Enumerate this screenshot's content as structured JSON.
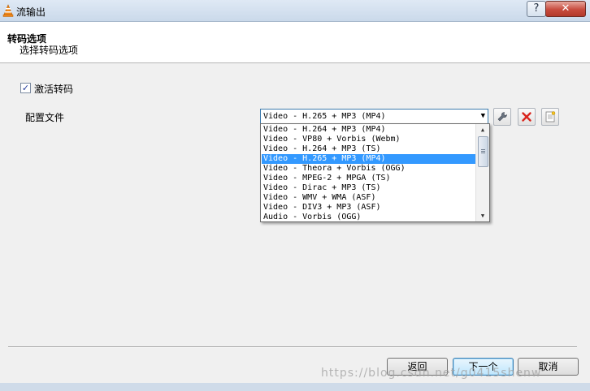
{
  "window": {
    "title": "流输出",
    "help_label": "?",
    "close_label": "✕"
  },
  "header": {
    "title": "转码选项",
    "subtitle": "选择转码选项"
  },
  "transcode": {
    "checkbox_label": "激活转码",
    "checked": true,
    "check_mark": "✓"
  },
  "profile": {
    "label": "配置文件",
    "selected": "Video - H.265 + MP3 (MP4)",
    "arrow": "▼",
    "buttons": [
      {
        "name": "edit-profile-button",
        "icon": "wrench-icon"
      },
      {
        "name": "delete-profile-button",
        "icon": "red-x-icon"
      },
      {
        "name": "new-profile-button",
        "icon": "new-document-icon"
      }
    ],
    "options": [
      "Video - H.264 + MP3 (MP4)",
      "Video - VP80 + Vorbis (Webm)",
      "Video - H.264 + MP3 (TS)",
      "Video - H.265 + MP3 (MP4)",
      "Video - Theora + Vorbis (OGG)",
      "Video - MPEG-2 + MPGA (TS)",
      "Video - Dirac + MP3 (TS)",
      "Video - WMV + WMA (ASF)",
      "Video - DIV3 + MP3 (ASF)",
      "Audio - Vorbis (OGG)"
    ],
    "selected_index": 3,
    "scroll_up": "▲",
    "scroll_down": "▼"
  },
  "footer": {
    "back_label": "返回",
    "next_label": "下一个",
    "cancel_label": "取消"
  },
  "watermark": "https://blog.csdn.net/g0415shenw",
  "colors": {
    "selection": "#3399ff",
    "accent_border": "#3d7bad",
    "delete_red": "#d9241c"
  }
}
